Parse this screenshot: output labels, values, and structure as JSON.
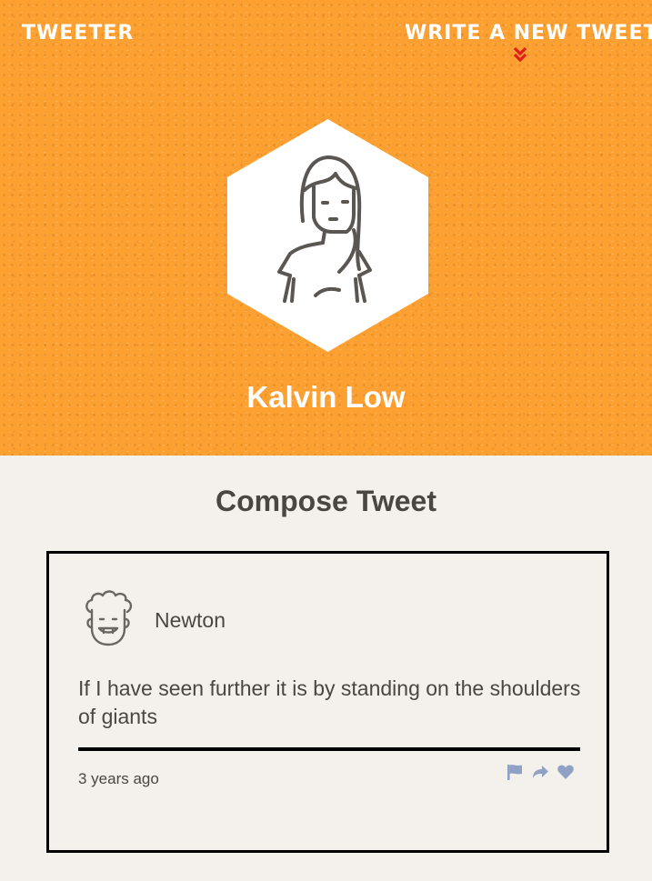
{
  "nav": {
    "brand": "TWEETER",
    "compose_link": "WRITE A NEW TWEET",
    "chevron_color": "#e0201b"
  },
  "profile": {
    "name": "Kalvin Low",
    "avatar_icon": "woman-avatar-icon"
  },
  "compose": {
    "title": "Compose Tweet"
  },
  "tweet": {
    "avatar_icon": "curly-hair-man-avatar-icon",
    "handle": "Newton",
    "text": "If I have seen further it is by standing on the shoulders of giants",
    "time": "3 years ago",
    "actions": [
      {
        "icon": "flag-icon"
      },
      {
        "icon": "retweet-icon"
      },
      {
        "icon": "heart-icon"
      }
    ],
    "action_color": "#8fa2c6"
  },
  "colors": {
    "header_bg": "#fda032",
    "page_bg": "#f4f1ec",
    "text": "#4a4642"
  }
}
